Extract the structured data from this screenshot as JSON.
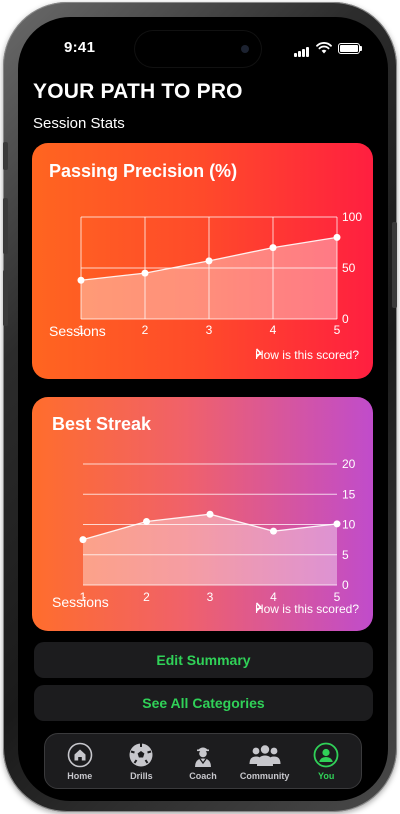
{
  "status": {
    "time": "9:41"
  },
  "header": {
    "title": "YOUR PATH TO PRO",
    "subtitle": "Session Stats"
  },
  "cards": [
    {
      "title": "Passing Precision (%)",
      "xlabel": "Sessions",
      "link": "How is this scored?"
    },
    {
      "title": "Best Streak",
      "xlabel": "Sessions",
      "link": "How is this scored?"
    }
  ],
  "buttons": {
    "edit": "Edit Summary",
    "see_all": "See All Categories"
  },
  "tabs": [
    {
      "label": "Home",
      "icon": "home-icon"
    },
    {
      "label": "Drills",
      "icon": "soccer-ball-icon"
    },
    {
      "label": "Coach",
      "icon": "coach-icon"
    },
    {
      "label": "Community",
      "icon": "community-icon"
    },
    {
      "label": "You",
      "icon": "profile-icon"
    }
  ],
  "colors": {
    "accent": "#30d158",
    "card1_start": "#ff6520",
    "card1_end": "#ff1f40",
    "card2_start": "#ff6d2c",
    "card2_end": "#c04ccb"
  },
  "chart_data": [
    {
      "type": "area",
      "title": "Passing Precision (%)",
      "xlabel": "Sessions",
      "x": [
        1,
        2,
        3,
        4,
        5
      ],
      "values": [
        38,
        45,
        57,
        70,
        80
      ],
      "xlim": [
        1,
        5
      ],
      "ylim": [
        0,
        100
      ],
      "yticks": [
        0,
        50,
        100
      ],
      "grid": "vertical and horizontal"
    },
    {
      "type": "area",
      "title": "Best Streak",
      "xlabel": "Sessions",
      "x": [
        1,
        2,
        3,
        4,
        5
      ],
      "values": [
        7.5,
        10.5,
        11.7,
        8.9,
        10.1
      ],
      "xlim": [
        1,
        5
      ],
      "ylim": [
        0,
        20
      ],
      "yticks": [
        0,
        5,
        10,
        15,
        20
      ],
      "grid": "horizontal"
    }
  ]
}
